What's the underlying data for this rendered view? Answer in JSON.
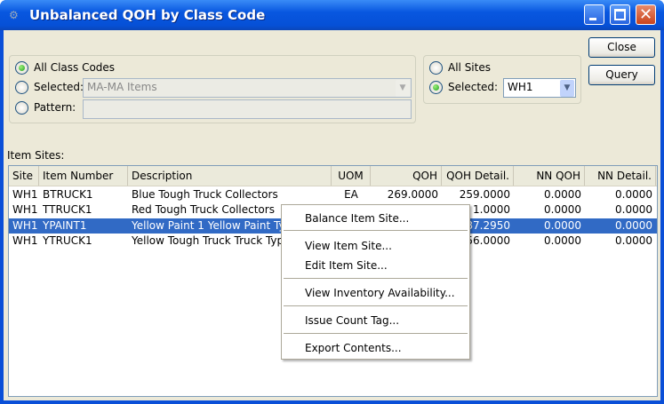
{
  "window": {
    "title": "Unbalanced QOH by Class Code"
  },
  "class_codes": {
    "all_label": "All Class Codes",
    "selected_label": "Selected:",
    "selected_value": "MA-MA Items",
    "pattern_label": "Pattern:",
    "pattern_value": "",
    "choice": "all"
  },
  "sites": {
    "all_label": "All Sites",
    "selected_label": "Selected:",
    "selected_value": "WH1",
    "choice": "selected"
  },
  "buttons": {
    "close": "Close",
    "query": "Query"
  },
  "item_sites": {
    "label": "Item Sites:",
    "columns": [
      "Site",
      "Item Number",
      "Description",
      "UOM",
      "QOH",
      "QOH Detail.",
      "NN QOH",
      "NN Detail."
    ],
    "rows": [
      [
        "WH1",
        "BTRUCK1",
        "Blue Tough Truck Collectors",
        "EA",
        "269.0000",
        "259.0000",
        "0.0000",
        "0.0000"
      ],
      [
        "WH1",
        "TTRUCK1",
        "Red Tough Truck Collectors",
        "",
        "",
        "1.0000",
        "0.0000",
        "0.0000"
      ],
      [
        "WH1",
        "YPAINT1",
        "Yellow Paint 1  Yellow Paint Ty",
        "",
        "",
        "87.2950",
        "0.0000",
        "0.0000"
      ],
      [
        "WH1",
        "YTRUCK1",
        "Yellow Tough Truck Truck Typ",
        "",
        "",
        "56.0000",
        "0.0000",
        "0.0000"
      ]
    ],
    "selected_row": 2
  },
  "context_menu": {
    "items": [
      "Balance Item Site...",
      "View Item Site...",
      "Edit Item Site...",
      "View Inventory Availability...",
      "Issue Count Tag...",
      "Export Contents..."
    ]
  }
}
